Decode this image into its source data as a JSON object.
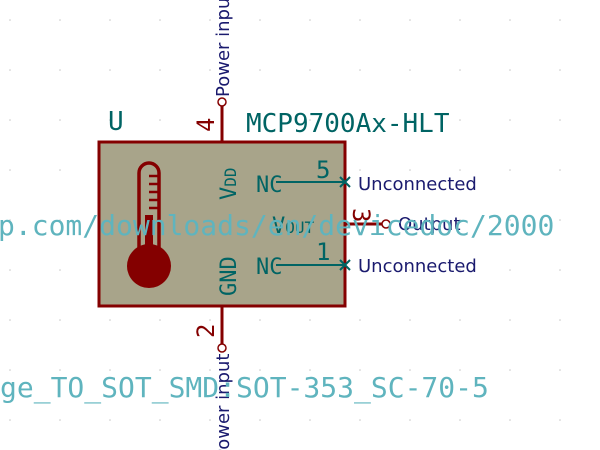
{
  "symbol": {
    "reference": "U",
    "value": "MCP9700Ax-HLT",
    "datasheet_fragment": "p.com/downloads/en/devicedoc/2000",
    "footprint_fragment": "ge_TO_SOT_SMD:SOT-353_SC-70-5"
  },
  "pins": {
    "vdd": {
      "number": "4",
      "name_main": "V",
      "name_sub": "DD",
      "net": "Power input"
    },
    "gnd": {
      "number": "2",
      "name": "GND",
      "net": "Power input"
    },
    "vout": {
      "number": "3",
      "name_main": "V",
      "name_sub": "OUT",
      "net": "Output"
    },
    "nc_top": {
      "number": "5",
      "name": "NC",
      "net": "Unconnected"
    },
    "nc_bottom": {
      "number": "1",
      "name": "NC",
      "net": "Unconnected"
    }
  },
  "colors": {
    "body_fill": "#a8a48a",
    "body_border": "#840000",
    "pin_wire": "#840000",
    "pin_label_text": "#006464",
    "net_label_text": "#1a1a6e",
    "field_text": "#5fb4be",
    "thermometer": "#840000",
    "grid_dot": "#c8c8c8"
  }
}
